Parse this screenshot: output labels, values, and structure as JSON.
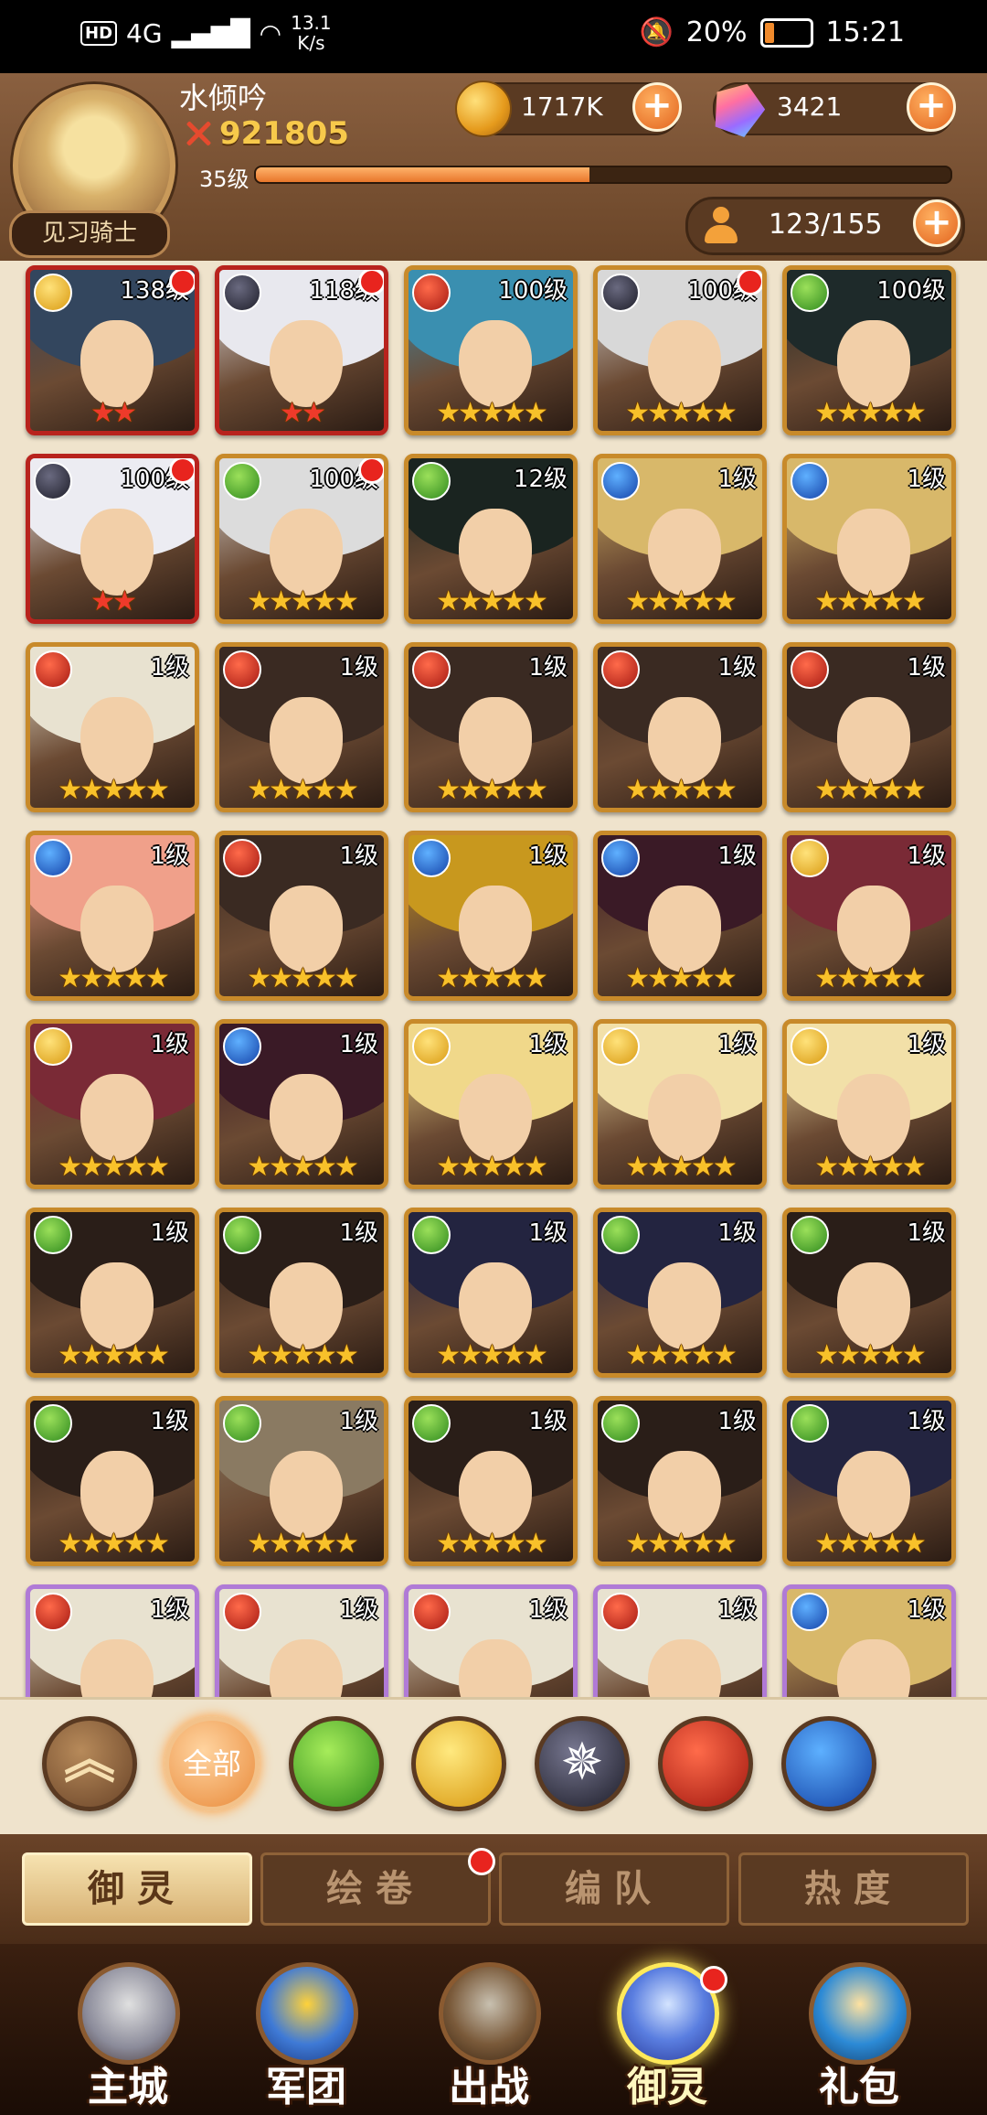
{
  "status_bar": {
    "network_badge": "HD",
    "signal": "4G",
    "speed": "13.1",
    "speed_unit": "K/s",
    "battery": "20%",
    "time": "15:21"
  },
  "player": {
    "name": "水倾吟",
    "power": "921805",
    "level": "35级",
    "title": "见习骑士",
    "xp_fraction": 0.48
  },
  "currencies": {
    "gold": "1717K",
    "gems": "3421"
  },
  "capacity": "123/155",
  "heroes": [
    {
      "level": "138级",
      "faction": "rose",
      "stars": "★★",
      "star_color": "red",
      "frame": "red",
      "dot": true,
      "hair": "#33465e"
    },
    {
      "level": "118级",
      "faction": "star",
      "stars": "★★",
      "star_color": "red",
      "frame": "red",
      "dot": true,
      "hair": "#e8e8ee"
    },
    {
      "level": "100级",
      "faction": "fire",
      "stars": "★★★★★",
      "star_color": "gold",
      "frame": "gold",
      "dot": false,
      "hair": "#3a8fb0"
    },
    {
      "level": "100级",
      "faction": "star",
      "stars": "★★★★★",
      "star_color": "gold",
      "frame": "gold",
      "dot": true,
      "hair": "#d8d8d8"
    },
    {
      "level": "100级",
      "faction": "wind",
      "stars": "★★★★★",
      "star_color": "gold",
      "frame": "gold",
      "dot": false,
      "hair": "#1e2a2a"
    },
    {
      "level": "100级",
      "faction": "star",
      "stars": "★★",
      "star_color": "red",
      "frame": "red",
      "dot": true,
      "hair": "#ececf2"
    },
    {
      "level": "100级",
      "faction": "wind",
      "stars": "★★★★★",
      "star_color": "gold",
      "frame": "gold",
      "dot": true,
      "hair": "#dcdcdc"
    },
    {
      "level": "12级",
      "faction": "wind",
      "stars": "★★★★★",
      "star_color": "gold",
      "frame": "gold",
      "dot": false,
      "hair": "#1a2420"
    },
    {
      "level": "1级",
      "faction": "water",
      "stars": "★★★★★",
      "star_color": "gold",
      "frame": "gold",
      "dot": false,
      "hair": "#d8b86a"
    },
    {
      "level": "1级",
      "faction": "water",
      "stars": "★★★★★",
      "star_color": "gold",
      "frame": "gold",
      "dot": false,
      "hair": "#d8b86a"
    },
    {
      "level": "1级",
      "faction": "fire",
      "stars": "★★★★★",
      "star_color": "gold",
      "frame": "gold",
      "dot": false,
      "hair": "#e8e2d0"
    },
    {
      "level": "1级",
      "faction": "fire",
      "stars": "★★★★★",
      "star_color": "gold",
      "frame": "gold",
      "dot": false,
      "hair": "#3a2a22"
    },
    {
      "level": "1级",
      "faction": "fire",
      "stars": "★★★★★",
      "star_color": "gold",
      "frame": "gold",
      "dot": false,
      "hair": "#3a2a22"
    },
    {
      "level": "1级",
      "faction": "fire",
      "stars": "★★★★★",
      "star_color": "gold",
      "frame": "gold",
      "dot": false,
      "hair": "#3a2a22"
    },
    {
      "level": "1级",
      "faction": "fire",
      "stars": "★★★★★",
      "star_color": "gold",
      "frame": "gold",
      "dot": false,
      "hair": "#3a2a22"
    },
    {
      "level": "1级",
      "faction": "water",
      "stars": "★★★★★",
      "star_color": "gold",
      "frame": "gold",
      "dot": false,
      "hair": "#f0a08a"
    },
    {
      "level": "1级",
      "faction": "fire",
      "stars": "★★★★★",
      "star_color": "gold",
      "frame": "gold",
      "dot": false,
      "hair": "#3a2a22"
    },
    {
      "level": "1级",
      "faction": "water",
      "stars": "★★★★★",
      "star_color": "gold",
      "frame": "gold",
      "dot": false,
      "hair": "#c8981e"
    },
    {
      "level": "1级",
      "faction": "water",
      "stars": "★★★★★",
      "star_color": "gold",
      "frame": "gold",
      "dot": false,
      "hair": "#3a1a26"
    },
    {
      "level": "1级",
      "faction": "rose",
      "stars": "★★★★★",
      "star_color": "gold",
      "frame": "gold",
      "dot": false,
      "hair": "#7a2a36"
    },
    {
      "level": "1级",
      "faction": "rose",
      "stars": "★★★★★",
      "star_color": "gold",
      "frame": "gold",
      "dot": false,
      "hair": "#7a2a36"
    },
    {
      "level": "1级",
      "faction": "water",
      "stars": "★★★★★",
      "star_color": "gold",
      "frame": "gold",
      "dot": false,
      "hair": "#3a1a26"
    },
    {
      "level": "1级",
      "faction": "rose",
      "stars": "★★★★★",
      "star_color": "gold",
      "frame": "gold",
      "dot": false,
      "hair": "#f0d88a"
    },
    {
      "level": "1级",
      "faction": "rose",
      "stars": "★★★★★",
      "star_color": "gold",
      "frame": "gold",
      "dot": false,
      "hair": "#f2e0a8"
    },
    {
      "level": "1级",
      "faction": "rose",
      "stars": "★★★★★",
      "star_color": "gold",
      "frame": "gold",
      "dot": false,
      "hair": "#f2e0a8"
    },
    {
      "level": "1级",
      "faction": "wind",
      "stars": "★★★★★",
      "star_color": "gold",
      "frame": "gold",
      "dot": false,
      "hair": "#2a1e18"
    },
    {
      "level": "1级",
      "faction": "wind",
      "stars": "★★★★★",
      "star_color": "gold",
      "frame": "gold",
      "dot": false,
      "hair": "#2a1e18"
    },
    {
      "level": "1级",
      "faction": "wind",
      "stars": "★★★★★",
      "star_color": "gold",
      "frame": "gold",
      "dot": false,
      "hair": "#232440"
    },
    {
      "level": "1级",
      "faction": "wind",
      "stars": "★★★★★",
      "star_color": "gold",
      "frame": "gold",
      "dot": false,
      "hair": "#232440"
    },
    {
      "level": "1级",
      "faction": "wind",
      "stars": "★★★★★",
      "star_color": "gold",
      "frame": "gold",
      "dot": false,
      "hair": "#2a1e18"
    },
    {
      "level": "1级",
      "faction": "wind",
      "stars": "★★★★★",
      "star_color": "gold",
      "frame": "gold",
      "dot": false,
      "hair": "#2a1e18"
    },
    {
      "level": "1级",
      "faction": "wind",
      "stars": "★★★★★",
      "star_color": "gold",
      "frame": "gold",
      "dot": false,
      "hair": "#8a7a62"
    },
    {
      "level": "1级",
      "faction": "wind",
      "stars": "★★★★★",
      "star_color": "gold",
      "frame": "gold",
      "dot": false,
      "hair": "#2a1e18"
    },
    {
      "level": "1级",
      "faction": "wind",
      "stars": "★★★★★",
      "star_color": "gold",
      "frame": "gold",
      "dot": false,
      "hair": "#2a1e18"
    },
    {
      "level": "1级",
      "faction": "wind",
      "stars": "★★★★★",
      "star_color": "gold",
      "frame": "gold",
      "dot": false,
      "hair": "#232440"
    },
    {
      "level": "1级",
      "faction": "fire",
      "stars": "",
      "star_color": "gold",
      "frame": "purple",
      "dot": false,
      "hair": "#e8e2d0"
    },
    {
      "level": "1级",
      "faction": "fire",
      "stars": "",
      "star_color": "gold",
      "frame": "purple",
      "dot": false,
      "hair": "#e8e2d0"
    },
    {
      "level": "1级",
      "faction": "fire",
      "stars": "",
      "star_color": "gold",
      "frame": "purple",
      "dot": false,
      "hair": "#e8e2d0"
    },
    {
      "level": "1级",
      "faction": "fire",
      "stars": "",
      "star_color": "gold",
      "frame": "purple",
      "dot": false,
      "hair": "#e8e2d0"
    },
    {
      "level": "1级",
      "faction": "water",
      "stars": "",
      "star_color": "gold",
      "frame": "purple",
      "dot": false,
      "hair": "#d8b86a"
    }
  ],
  "filters": {
    "up_label": "︽",
    "all_label": "全部",
    "items": [
      "wind-icon",
      "rose-icon",
      "star-icon",
      "fire-icon",
      "water-icon"
    ]
  },
  "subtabs": [
    {
      "label": "御灵",
      "active": true
    },
    {
      "label": "绘卷",
      "active": false,
      "dot": true
    },
    {
      "label": "编队",
      "active": false
    },
    {
      "label": "热度",
      "active": false
    }
  ],
  "bottom_nav": [
    {
      "label": "主城"
    },
    {
      "label": "军团"
    },
    {
      "label": "出战"
    },
    {
      "label": "御灵",
      "active": true,
      "dot": true
    },
    {
      "label": "礼包"
    }
  ]
}
